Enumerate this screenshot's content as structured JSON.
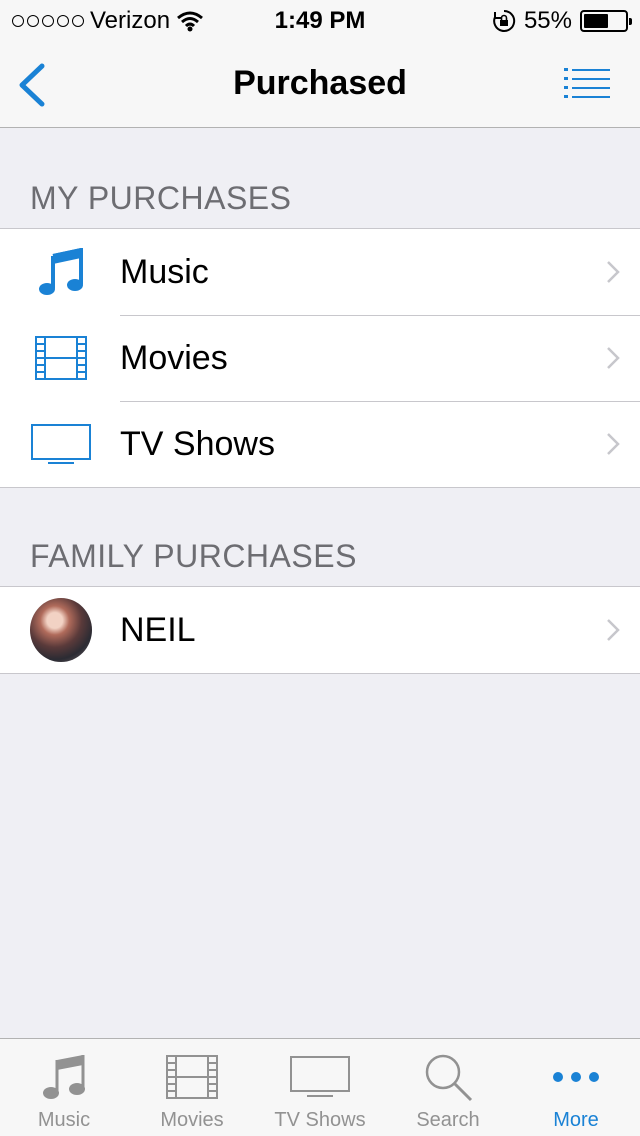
{
  "status_bar": {
    "carrier": "Verizon",
    "time": "1:49 PM",
    "battery": "55%",
    "battery_level": 0.55
  },
  "nav": {
    "title": "Purchased",
    "back_icon": "chevron-left-icon",
    "list_icon": "list-icon"
  },
  "my_purchases": {
    "header": "MY PURCHASES",
    "items": [
      {
        "label": "Music",
        "icon": "music-note-icon"
      },
      {
        "label": "Movies",
        "icon": "film-icon"
      },
      {
        "label": "TV Shows",
        "icon": "tv-icon"
      }
    ]
  },
  "family_purchases": {
    "header": "FAMILY PURCHASES",
    "items": [
      {
        "label": "NEIL",
        "icon": "avatar"
      }
    ]
  },
  "tab_bar": {
    "tabs": [
      {
        "label": "Music",
        "icon": "music-note-icon"
      },
      {
        "label": "Movies",
        "icon": "film-icon"
      },
      {
        "label": "TV Shows",
        "icon": "tv-icon"
      },
      {
        "label": "Search",
        "icon": "search-icon"
      },
      {
        "label": "More",
        "icon": "more-icon"
      }
    ],
    "active": "More"
  },
  "colors": {
    "accent": "#1a82d5",
    "inactive": "#929292",
    "background": "#efeff4"
  }
}
